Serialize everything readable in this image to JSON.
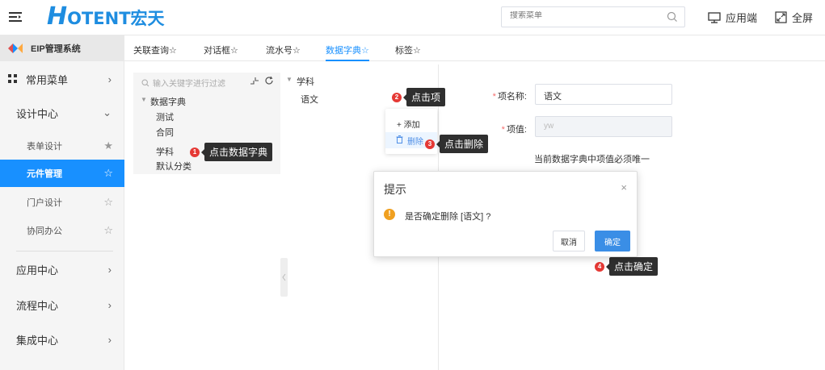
{
  "header": {
    "logo_h": "H",
    "logo_rest": "OTENT宏天",
    "search_placeholder": "搜索菜单",
    "app_label": "应用端",
    "fullscreen_label": "全屏"
  },
  "sidebar": {
    "system_title": "EIP管理系统",
    "items": [
      {
        "label": "常用菜单",
        "arrow": "›"
      },
      {
        "label": "设计中心",
        "arrow": "⌄"
      },
      {
        "label": "应用中心",
        "arrow": "›"
      },
      {
        "label": "流程中心",
        "arrow": "›"
      },
      {
        "label": "集成中心",
        "arrow": "›"
      }
    ],
    "sub_items": [
      {
        "label": "表单设计",
        "star": "★"
      },
      {
        "label": "元件管理",
        "star": "☆"
      },
      {
        "label": "门户设计",
        "star": "☆"
      },
      {
        "label": "协同办公",
        "star": "☆"
      }
    ]
  },
  "tabs": [
    "关联查询☆",
    "对话框☆",
    "流水号☆",
    "数据字典☆",
    "标签☆"
  ],
  "tree": {
    "filter_placeholder": "输入关键字进行过滤",
    "root": "数据字典",
    "children": [
      "测试",
      "合同",
      "学科",
      "默认分类"
    ]
  },
  "mid_tree": {
    "node": "学科",
    "child": "语文"
  },
  "context_menu": {
    "add": "+ 添加",
    "delete": "删除"
  },
  "callouts": [
    {
      "num": "1",
      "text": "点击数据字典"
    },
    {
      "num": "2",
      "text": "点击项"
    },
    {
      "num": "3",
      "text": "点击删除"
    },
    {
      "num": "4",
      "text": "点击确定"
    }
  ],
  "form": {
    "name_label": "项名称:",
    "name_value": "语文",
    "value_label": "项值:",
    "value_value": "yw",
    "hint": "当前数据字典中项值必须唯一",
    "required_mark": "*"
  },
  "dialog": {
    "title": "提示",
    "close": "×",
    "warn_icon": "!",
    "message": "是否确定删除 [语文] ?",
    "cancel": "取消",
    "confirm": "确定"
  },
  "colors": {
    "accent": "#1890ff",
    "callout_red": "#e53935",
    "callout_dark": "#2f2f2f",
    "warning": "#f0a020"
  }
}
